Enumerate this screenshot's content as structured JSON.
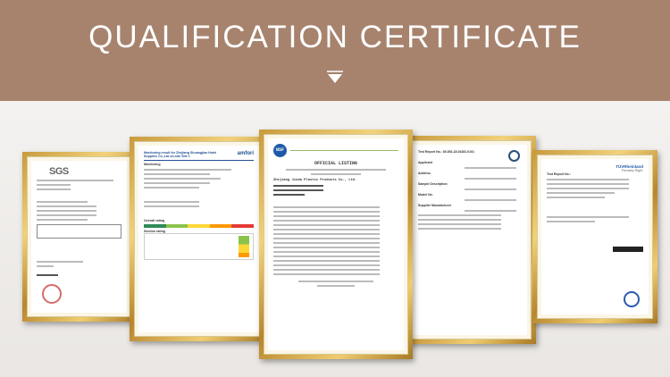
{
  "header": {
    "title": "QUALIFICATION CERTIFICATE"
  },
  "certificates": [
    {
      "name": "SGS",
      "logo": "SGS"
    },
    {
      "name": "amfori",
      "heading": "Monitoring result for Zhejiang Shuangjiao Hotel Supplies Co.,Ltd on-site Site 1",
      "logo": "amfori",
      "section": "Monitoring",
      "section2": "Overall rating",
      "section3": "Section rating"
    },
    {
      "name": "NSF",
      "logo": "NSF",
      "heading": "OFFICIAL LISTING",
      "company": "Zhejiang Jinda Plastic Products Co., Ltd."
    },
    {
      "name": "Test Report",
      "report_no": "Test Report No.: 80.851.18.04381.0101",
      "applicant": "Applicant",
      "address": "Address",
      "sample": "Sample Description",
      "model": "Model No.",
      "manufacturer": "Supplier Manufacturer"
    },
    {
      "name": "TUV Rheinland",
      "logo": "TÜVRheinland",
      "report": "Test Report No.:",
      "sub": "Precisely Right."
    }
  ],
  "colors": {
    "banner": "#a7836e",
    "frame": "#d4a94a"
  }
}
